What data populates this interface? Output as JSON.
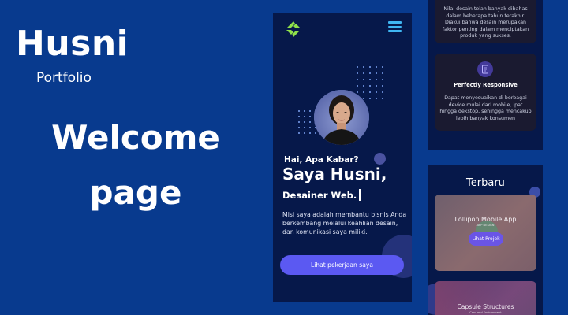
{
  "left": {
    "title": "Husni",
    "subtitle": "Portfolio",
    "headline": "Welcome page"
  },
  "phone": {
    "greeting": "Hai, Apa Kabar?",
    "name": "Saya Husni,",
    "role": "Desainer Web.",
    "mission": "Misi saya adalah membantu bisnis Anda berkembang melalui keahlian desain, dan komunikasi saya miliki.",
    "cta_label": "Lihat pekerjaan saya",
    "accent": "#5b59f2",
    "menu_color": "#3fb6f2",
    "logo_color": "#8ee04a"
  },
  "features": {
    "design_text": "Nilai desain telah banyak dibahas dalam beberapa tahun terakhir. Diakui bahwa desain merupakan faktor penting dalam menciptakan produk yang sukses.",
    "responsive_title": "Perfectly Responsive",
    "responsive_text": "Dapat menyesuaikan di berbagai device mulai dari mobile, ipat hingga dekstop, sehingga mencakup lebih banyak konsumen",
    "responsive_icon": "document-icon"
  },
  "latest": {
    "title": "Terbaru",
    "projects": [
      {
        "title": "Lollipop Mobile App",
        "tag": "APP DESIGN",
        "button": "Lihat Projek"
      },
      {
        "title": "Capsule Structures",
        "tag": "Card and Environment"
      }
    ]
  }
}
